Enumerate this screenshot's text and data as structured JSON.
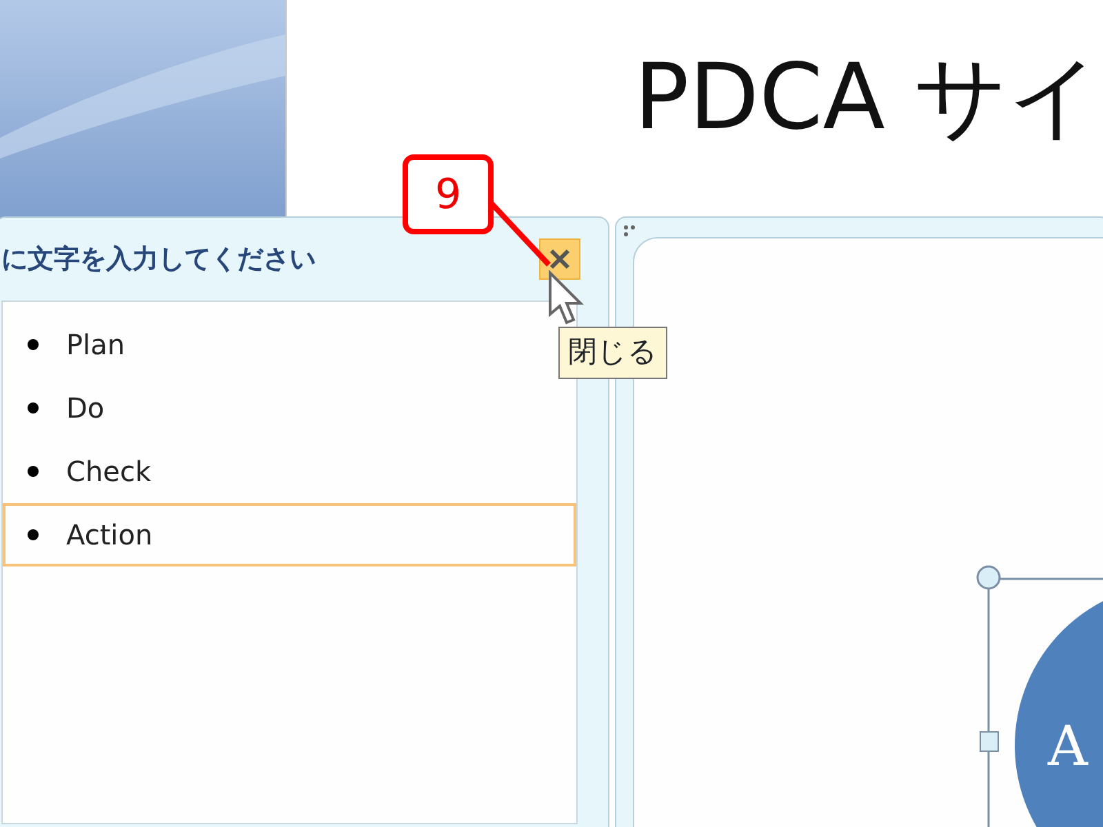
{
  "slide": {
    "title": "PDCA サイ"
  },
  "text_pane": {
    "title": "に文字を入力してください",
    "tooltip": "閉じる",
    "items": [
      {
        "text": "Plan",
        "selected": false
      },
      {
        "text": "Do",
        "selected": false
      },
      {
        "text": "Check",
        "selected": false
      },
      {
        "text": "Action",
        "selected": true
      }
    ]
  },
  "callout": {
    "label": "9"
  },
  "smartart": {
    "shape_label": "A"
  }
}
